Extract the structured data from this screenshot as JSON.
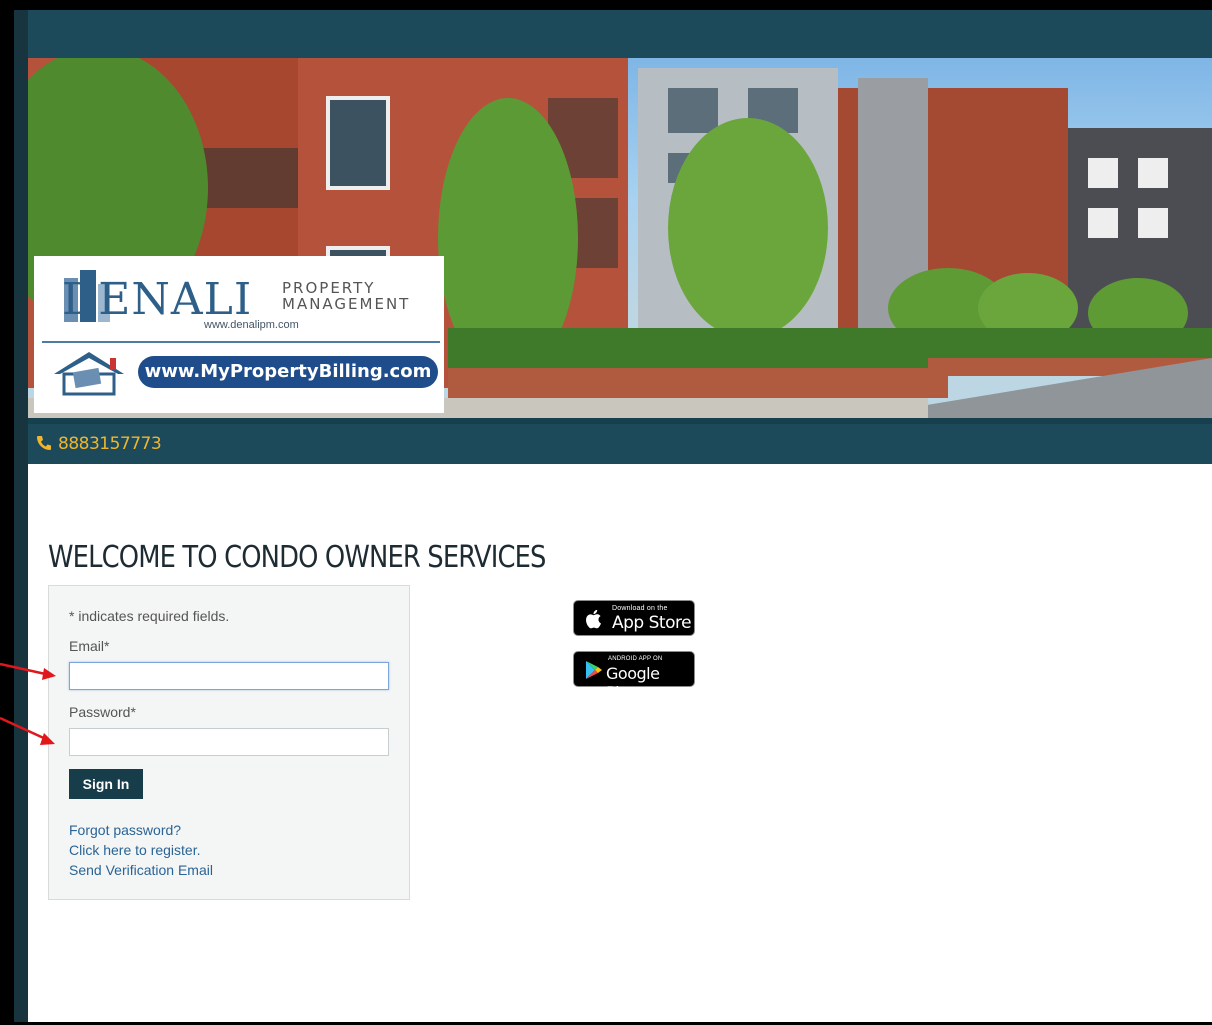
{
  "header": {
    "phone": "8883157773"
  },
  "banner": {
    "logo_name": "DENALI",
    "logo_sub_1": "PROPERTY",
    "logo_sub_2": "MANAGEMENT",
    "logo_url": "www.denalipm.com",
    "billing_url": "www.MyPropertyBilling.com"
  },
  "page": {
    "title": "WELCOME TO CONDO OWNER SERVICES"
  },
  "login": {
    "required_note": "* indicates required fields.",
    "email_label": "Email*",
    "email_value": "",
    "password_label": "Password*",
    "password_value": "",
    "sign_in_label": "Sign In",
    "links": {
      "forgot": "Forgot password?",
      "register": "Click here to register.",
      "verify": "Send Verification Email"
    }
  },
  "apps": {
    "appstore_small": "Download on the",
    "appstore_big": "App Store",
    "googleplay_small": "ANDROID APP ON",
    "googleplay_big": "Google Play"
  },
  "colors": {
    "header_bg": "#1d4a5a",
    "phone_text": "#f0b52b",
    "button_bg": "#173d4a",
    "link": "#2a6496",
    "annotation_arrow": "#e0171b"
  }
}
